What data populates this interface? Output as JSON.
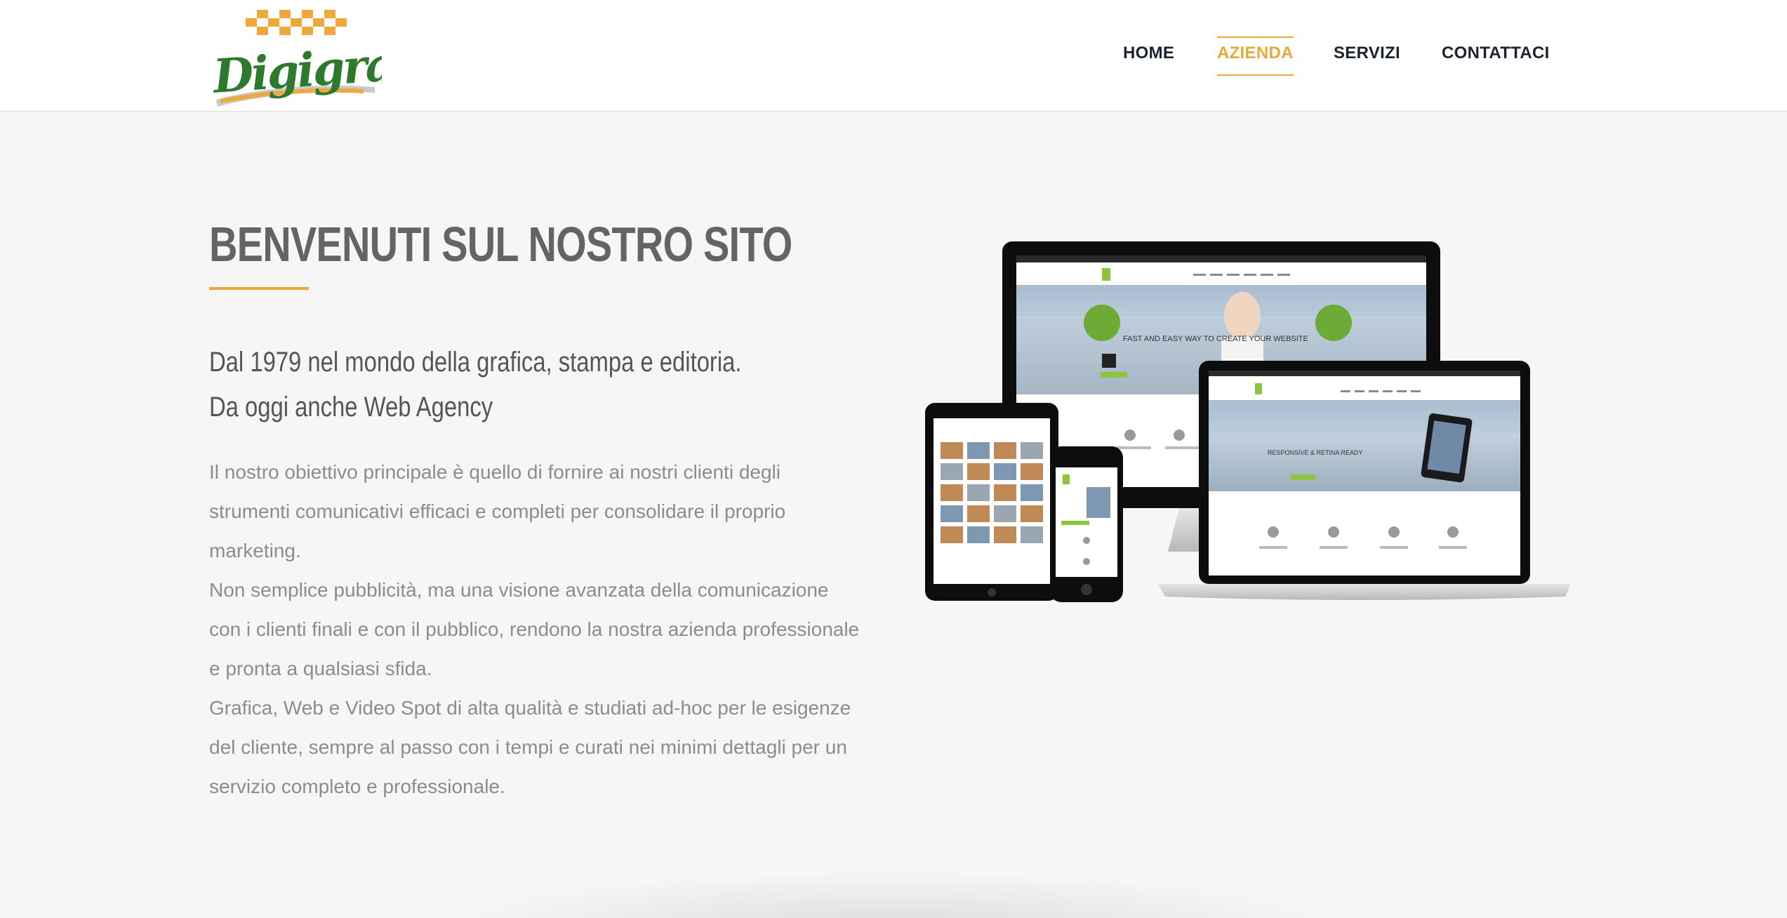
{
  "logo": {
    "text": "Digigraf"
  },
  "nav": {
    "home": "HOME",
    "azienda": "AZIENDA",
    "servizi": "SERVIZI",
    "contattaci": "CONTATTACI"
  },
  "hero": {
    "title": "BENVENUTI SUL NOSTRO SITO",
    "subtitle_line1": "Dal 1979 nel mondo della grafica, stampa e editoria.",
    "subtitle_line2": "Da oggi anche Web Agency",
    "paragraph1": "Il nostro obiettivo principale è quello di fornire ai nostri clienti degli strumenti comunicativi efficaci e completi per consolidare il proprio marketing.",
    "paragraph2": "Non semplice pubblicità, ma una visione avanzata della comunicazione con i clienti finali e con il pubblico, rendono la nostra azienda professionale e pronta a qualsiasi sfida.",
    "paragraph3": "Grafica, Web e Video Spot di alta qualità e studiati ad-hoc per le esigenze del cliente, sempre al passo con i tempi e curati nei minimi dettagli per un servizio completo e professionale."
  },
  "mockup": {
    "desktop_banner": "FAST AND EASY WAY TO CREATE YOUR WEBSITE",
    "laptop_banner": "RESPONSIVE & RETINA READY"
  },
  "colors": {
    "accent": "#e9a93a",
    "logo_green": "#2e7a2e",
    "nav_text": "#1c2330",
    "title": "#646464",
    "body_text": "#8c8c8c"
  }
}
